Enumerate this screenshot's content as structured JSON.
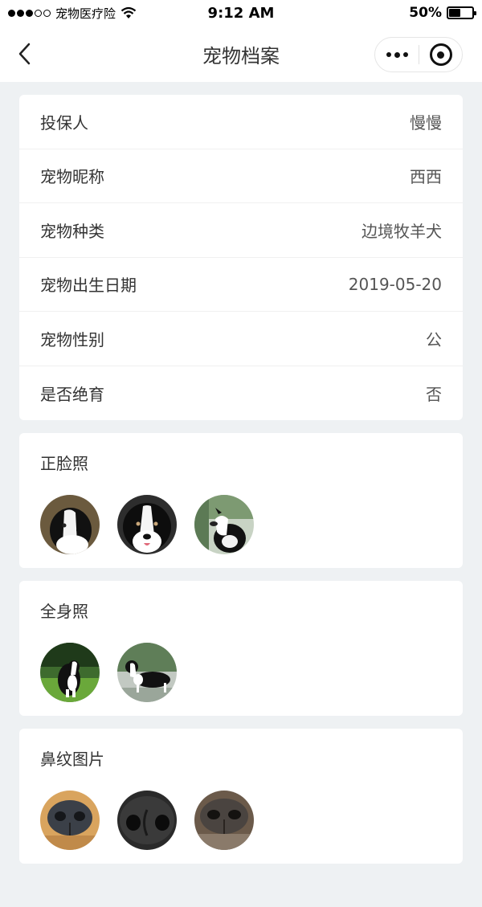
{
  "status": {
    "carrier": "宠物医疗险",
    "time": "9:12 AM",
    "battery": "50%",
    "battery_level": 0.5
  },
  "nav": {
    "title": "宠物档案"
  },
  "info": [
    {
      "label": "投保人",
      "value": "慢慢"
    },
    {
      "label": "宠物昵称",
      "value": "西西"
    },
    {
      "label": "宠物种类",
      "value": "边境牧羊犬"
    },
    {
      "label": "宠物出生日期",
      "value": "2019-05-20"
    },
    {
      "label": "宠物性别",
      "value": "公"
    },
    {
      "label": "是否绝育",
      "value": "否"
    }
  ],
  "sections": {
    "face": {
      "title": "正脸照"
    },
    "body": {
      "title": "全身照"
    },
    "nose": {
      "title": "鼻纹图片"
    }
  }
}
